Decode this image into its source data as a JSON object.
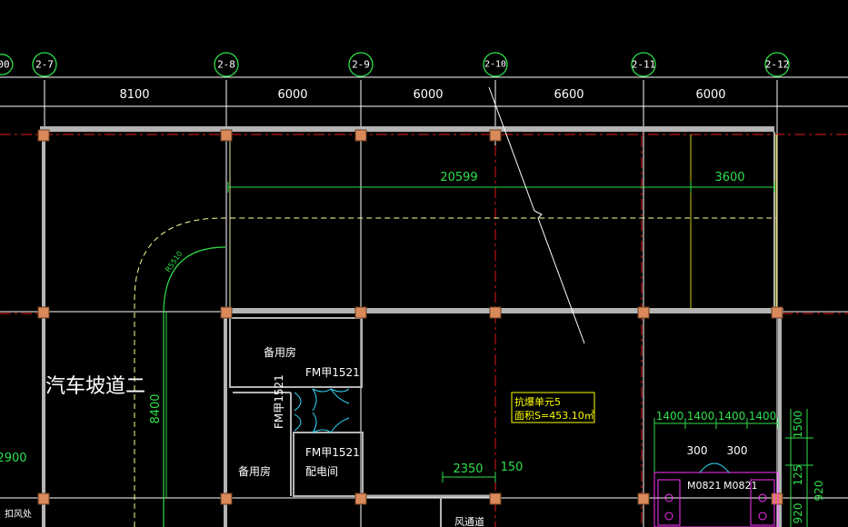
{
  "axes": {
    "left_partial": "00",
    "items": [
      "2-7",
      "2-8",
      "2-9",
      "2-10",
      "2-11",
      "2-12"
    ]
  },
  "dims_top": [
    "8100",
    "6000",
    "6000",
    "6600",
    "6000"
  ],
  "dims_inner": [
    "20599",
    "3600"
  ],
  "radius_label": "R5510",
  "vertical_dim": "8400",
  "ramp_label": "汽车坡道二",
  "rooms": {
    "spare_1": "备用房",
    "door_fm_1": "FM甲1521",
    "door_fm_vertical": "FM甲1521",
    "door_fm_2": "FM甲1521",
    "power_room": "配电间",
    "spare_2": "备用房"
  },
  "blast_unit": {
    "title": "抗爆单元5",
    "area": "面积S=453.10㎡"
  },
  "small_dims": {
    "d2350": "2350",
    "d150": "150",
    "d2900": "2900",
    "right_1400": [
      "1400",
      "1400",
      "1400",
      "1400"
    ],
    "right_300": [
      "300",
      "300"
    ],
    "right_1500": "1500",
    "right_125": "125",
    "right_920a": "920",
    "right_920b": "920"
  },
  "doors_bottom_right": [
    "M0821",
    "M0821"
  ],
  "partial_bottom_left": "扣风处",
  "partial_bottom_mid": "风通道",
  "colors": {
    "background": "#000000",
    "axis_green": "#2ee04a",
    "wall_gray": "#b4b4b4",
    "column_orange": "#d9895a",
    "red_axis": "#e01818",
    "yellow": "#ffff00",
    "magenta": "#ff33ff",
    "cyan": "#33ddff"
  }
}
